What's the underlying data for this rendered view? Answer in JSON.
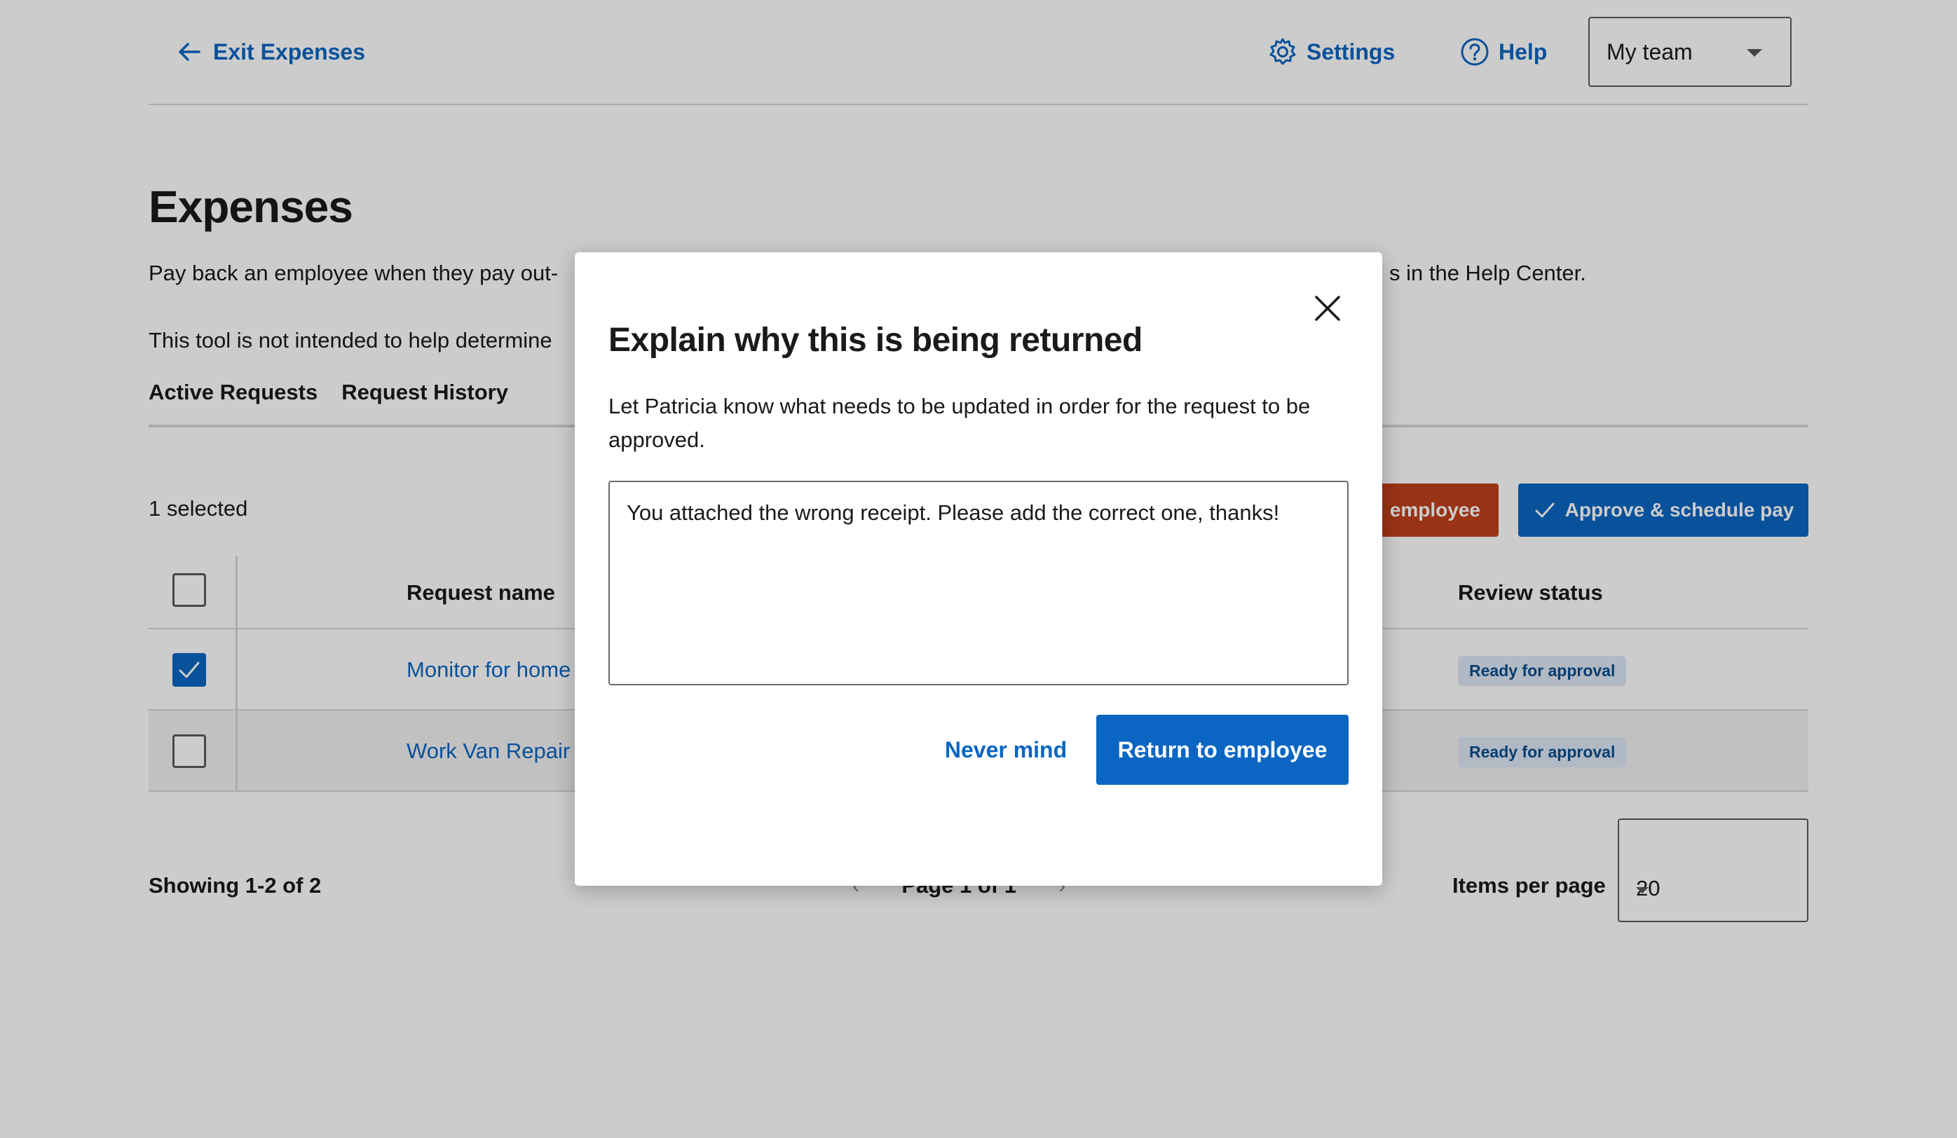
{
  "colors": {
    "primary": "#0a66c2",
    "danger": "#c0401b",
    "badge_bg": "#dce8f5",
    "overlay": "rgba(0,0,0,0.2)"
  },
  "header": {
    "exit_label": "Exit Expenses",
    "settings_label": "Settings",
    "help_label": "Help",
    "team_select_value": "My team"
  },
  "page": {
    "title": "Expenses",
    "description_start": "Pay back an employee when they pay out-",
    "description_end": "s in the Help Center.",
    "note": "This tool is not intended to help determine",
    "tabs": [
      "Active Requests",
      "Request History"
    ]
  },
  "toolbar": {
    "selected_count": "1 selected",
    "return_label": "employee",
    "approve_label": "Approve & schedule pay"
  },
  "table": {
    "headers": {
      "name": "Request name",
      "status": "Review status"
    },
    "rows": [
      {
        "name": "Monitor for home",
        "status": "Ready for approval",
        "checked": true
      },
      {
        "name": "Work Van Repair",
        "status": "Ready for approval",
        "checked": false
      }
    ]
  },
  "footer": {
    "showing": "Showing 1-2 of 2",
    "page": "Page 1 of 1",
    "items_per_page_label": "Items per page",
    "items_per_page_value": "20"
  },
  "modal": {
    "title": "Explain why this is being returned",
    "body": "Let Patricia know what needs to be updated in order for the request to be approved.",
    "textarea_value": "You attached the wrong receipt. Please add the correct one, thanks!",
    "cancel_label": "Never mind",
    "confirm_label": "Return to employee"
  }
}
